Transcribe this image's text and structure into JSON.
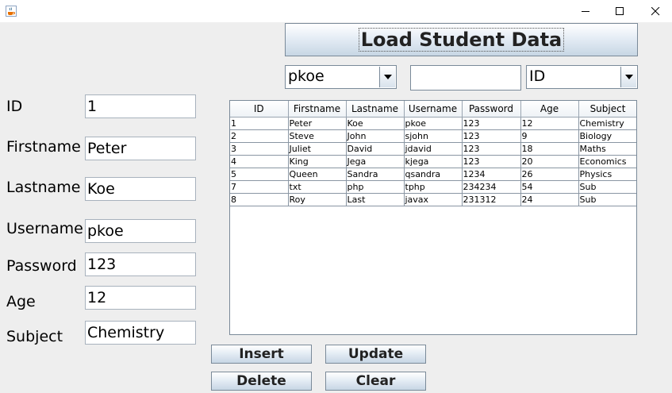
{
  "titlebar": {
    "icons": {
      "app": "java-cup-icon",
      "minimize": "minimize-icon",
      "maximize": "maximize-icon",
      "close": "close-icon"
    }
  },
  "load_button_label": "Load Student Data",
  "search": {
    "username_combo_value": "pkoe",
    "search_text": "",
    "field_combo_value": "ID"
  },
  "form": {
    "id_label": "ID",
    "id_value": "1",
    "firstname_label": "Firstname",
    "firstname_value": "Peter",
    "lastname_label": "Lastname",
    "lastname_value": "Koe",
    "username_label": "Username",
    "username_value": "pkoe",
    "password_label": "Password",
    "password_value": "123",
    "age_label": "Age",
    "age_value": "12",
    "subject_label": "Subject",
    "subject_value": "Chemistry"
  },
  "table": {
    "columns": [
      "ID",
      "Firstname",
      "Lastname",
      "Username",
      "Password",
      "Age",
      "Subject"
    ],
    "rows": [
      [
        "1",
        "Peter",
        "Koe",
        "pkoe",
        "123",
        "12",
        "Chemistry"
      ],
      [
        "2",
        "Steve",
        "John",
        "sjohn",
        "123",
        "9",
        "Biology"
      ],
      [
        "3",
        "Juliet",
        "David",
        "jdavid",
        "123",
        "18",
        "Maths"
      ],
      [
        "4",
        "King",
        "Jega",
        "kjega",
        "123",
        "20",
        "Economics"
      ],
      [
        "5",
        "Queen",
        "Sandra",
        "qsandra",
        "1234",
        "26",
        "Physics"
      ],
      [
        "7",
        "txt",
        "php",
        "tphp",
        "234234",
        "54",
        "Sub"
      ],
      [
        "8",
        "Roy",
        "Last",
        "javax",
        "231312",
        "24",
        "Sub"
      ]
    ]
  },
  "buttons": {
    "insert": "Insert",
    "update": "Update",
    "delete": "Delete",
    "clear": "Clear"
  }
}
